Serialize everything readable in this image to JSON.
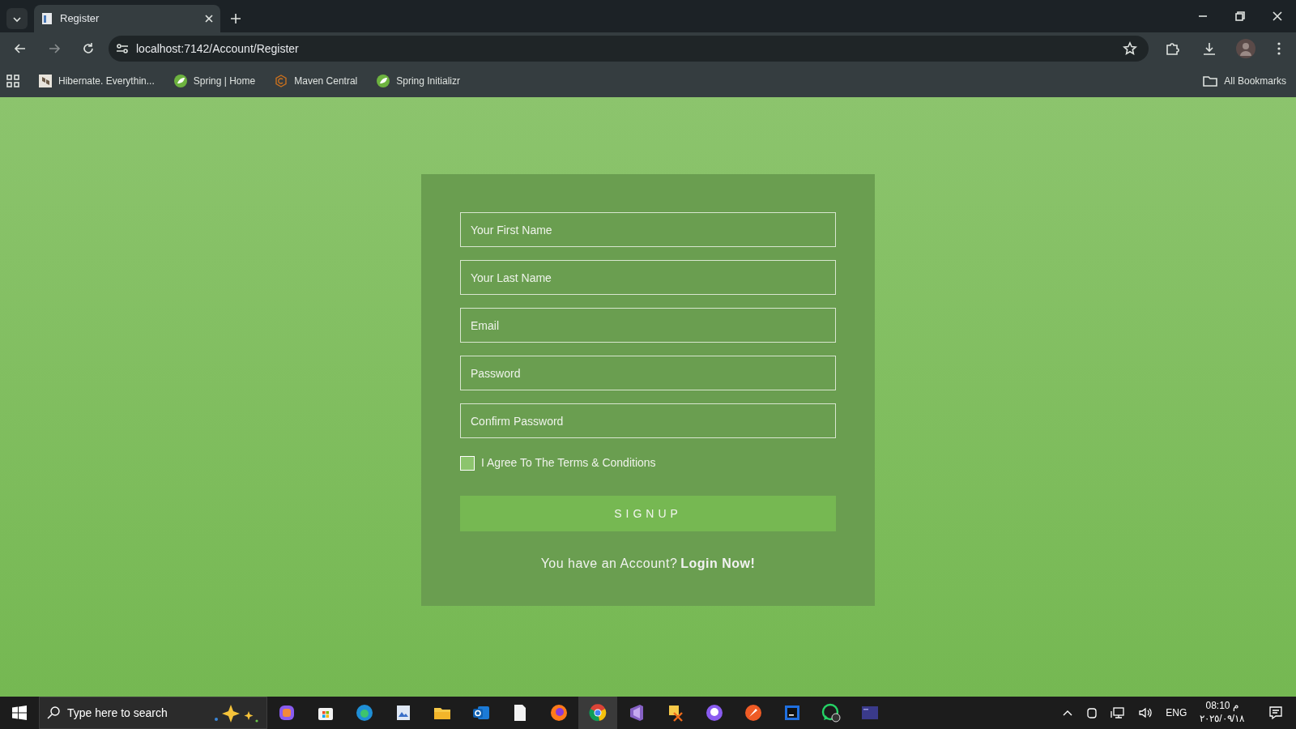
{
  "browser": {
    "tab": {
      "title": "Register",
      "selected": true
    },
    "url": "localhost:7142/Account/Register",
    "bookmarks": [
      {
        "label": "Hibernate. Everythin..."
      },
      {
        "label": "Spring | Home"
      },
      {
        "label": "Maven Central"
      },
      {
        "label": "Spring Initializr"
      }
    ],
    "all_bookmarks": "All Bookmarks"
  },
  "form": {
    "fields": [
      {
        "placeholder": "Your First Name"
      },
      {
        "placeholder": "Your Last Name"
      },
      {
        "placeholder": "Email"
      },
      {
        "placeholder": "Password"
      },
      {
        "placeholder": "Confirm Password"
      }
    ],
    "terms": {
      "label": "I Agree To The Terms & Conditions",
      "checked": false
    },
    "submit": "SIGNUP",
    "login_prompt": "You have an Account?",
    "login_link": "Login Now!"
  },
  "taskbar": {
    "search_placeholder": "Type here to search",
    "language": "ENG",
    "time": "08:10 م",
    "date": "٢٠٢٥/٠٩/١٨"
  }
}
